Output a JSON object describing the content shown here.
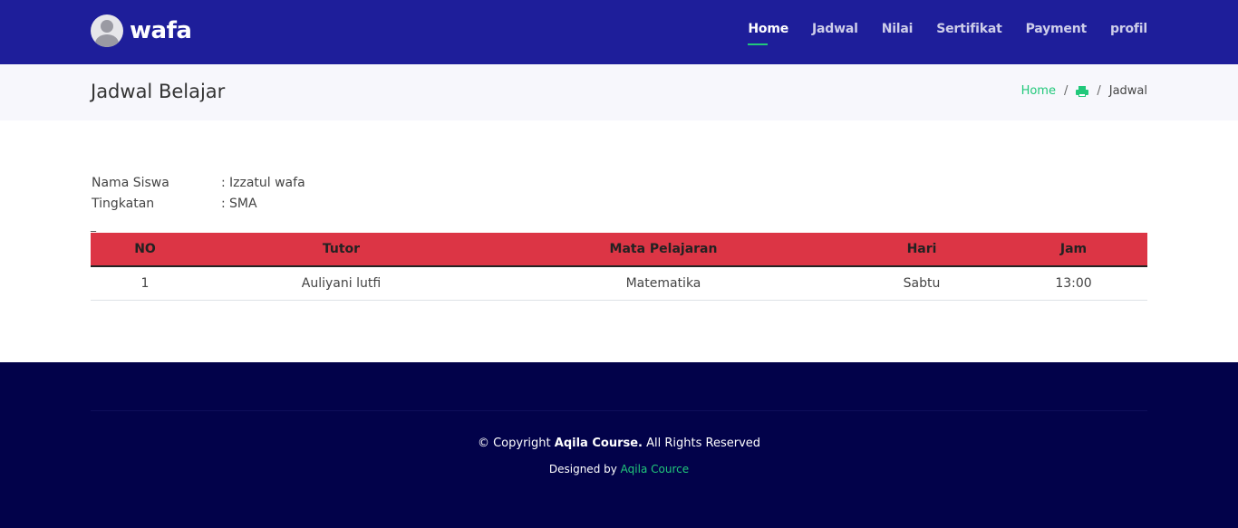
{
  "brand": {
    "name": "wafa"
  },
  "nav": {
    "items": [
      {
        "label": "Home"
      },
      {
        "label": "Jadwal"
      },
      {
        "label": "Nilai"
      },
      {
        "label": "Sertifikat"
      },
      {
        "label": "Payment"
      },
      {
        "label": "profil"
      }
    ]
  },
  "page": {
    "title": "Jadwal Belajar",
    "breadcrumb": {
      "home": "Home",
      "separator": "/",
      "current": "Jadwal",
      "icon": "print-icon"
    }
  },
  "student": {
    "name_label": "Nama Siswa",
    "name_value": "Izzatul wafa",
    "level_label": "Tingkatan",
    "level_value": "SMA",
    "colon": ":"
  },
  "dash": "_",
  "table": {
    "headers": [
      "NO",
      "Tutor",
      "Mata Pelajaran",
      "Hari",
      "Jam"
    ],
    "rows": [
      [
        "1",
        "Auliyani lutfi",
        "Matematika",
        "Sabtu",
        "13:00"
      ]
    ]
  },
  "footer": {
    "copyright_prefix": "© Copyright",
    "company": "Aqila Course.",
    "rights": "All Rights Reserved",
    "designed_by": "Designed by",
    "designer": "Aqila Cource"
  },
  "colors": {
    "header_bg": "#1e1e9a",
    "accent": "#21c87a",
    "table_header": "#dc3545",
    "footer_bg": "#02024a"
  }
}
